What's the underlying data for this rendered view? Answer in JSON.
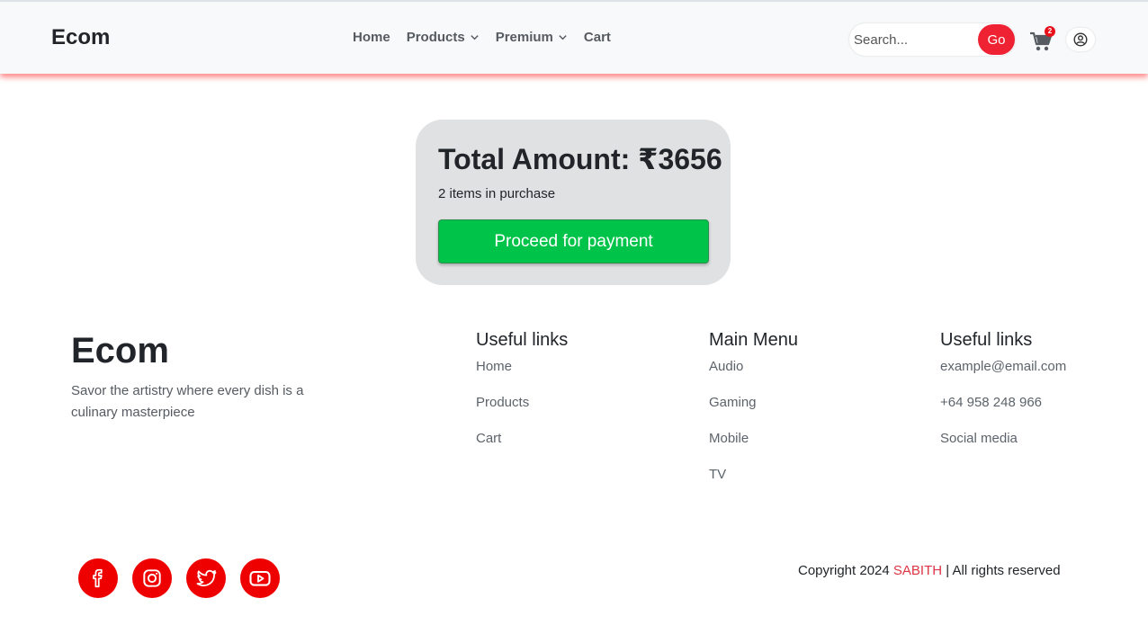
{
  "nav": {
    "brand": "Ecom",
    "links": [
      {
        "label": "Home"
      },
      {
        "label": "Products"
      },
      {
        "label": "Premium"
      },
      {
        "label": "Cart"
      }
    ],
    "search_placeholder": "Search...",
    "search_value": "",
    "go_label": "Go",
    "cart_count": "2",
    "icons": {
      "cart": "cart-icon",
      "user": "user-circle-icon",
      "dropdown": "chevron-down-icon"
    }
  },
  "summary": {
    "total_label": "Total Amount: ₹3656",
    "items_text": "2 items in purchase",
    "pay_button": "Proceed for payment"
  },
  "footer": {
    "brand": "Ecom",
    "tagline": "Savor the artistry where every dish is a culinary masterpiece",
    "columns": [
      {
        "title": "Useful links",
        "items": [
          "Home",
          "Products",
          "Cart"
        ]
      },
      {
        "title": "Main Menu",
        "items": [
          "Audio",
          "Gaming",
          "Mobile",
          "TV"
        ]
      },
      {
        "title": "Useful links",
        "items": [
          "example@email.com",
          "+64 958 248 966",
          "Social media"
        ]
      }
    ],
    "social": [
      "facebook-icon",
      "instagram-icon",
      "twitter-icon",
      "youtube-icon"
    ],
    "copyright_prefix": "Copyright 2024 ",
    "copyright_author": "SABITH",
    "copyright_suffix": " | All rights reserved"
  },
  "colors": {
    "accent": "#ee2233",
    "pay_button": "#00c44a",
    "summary_bg": "#e0e1e3",
    "social_bg": "#ee0000"
  }
}
